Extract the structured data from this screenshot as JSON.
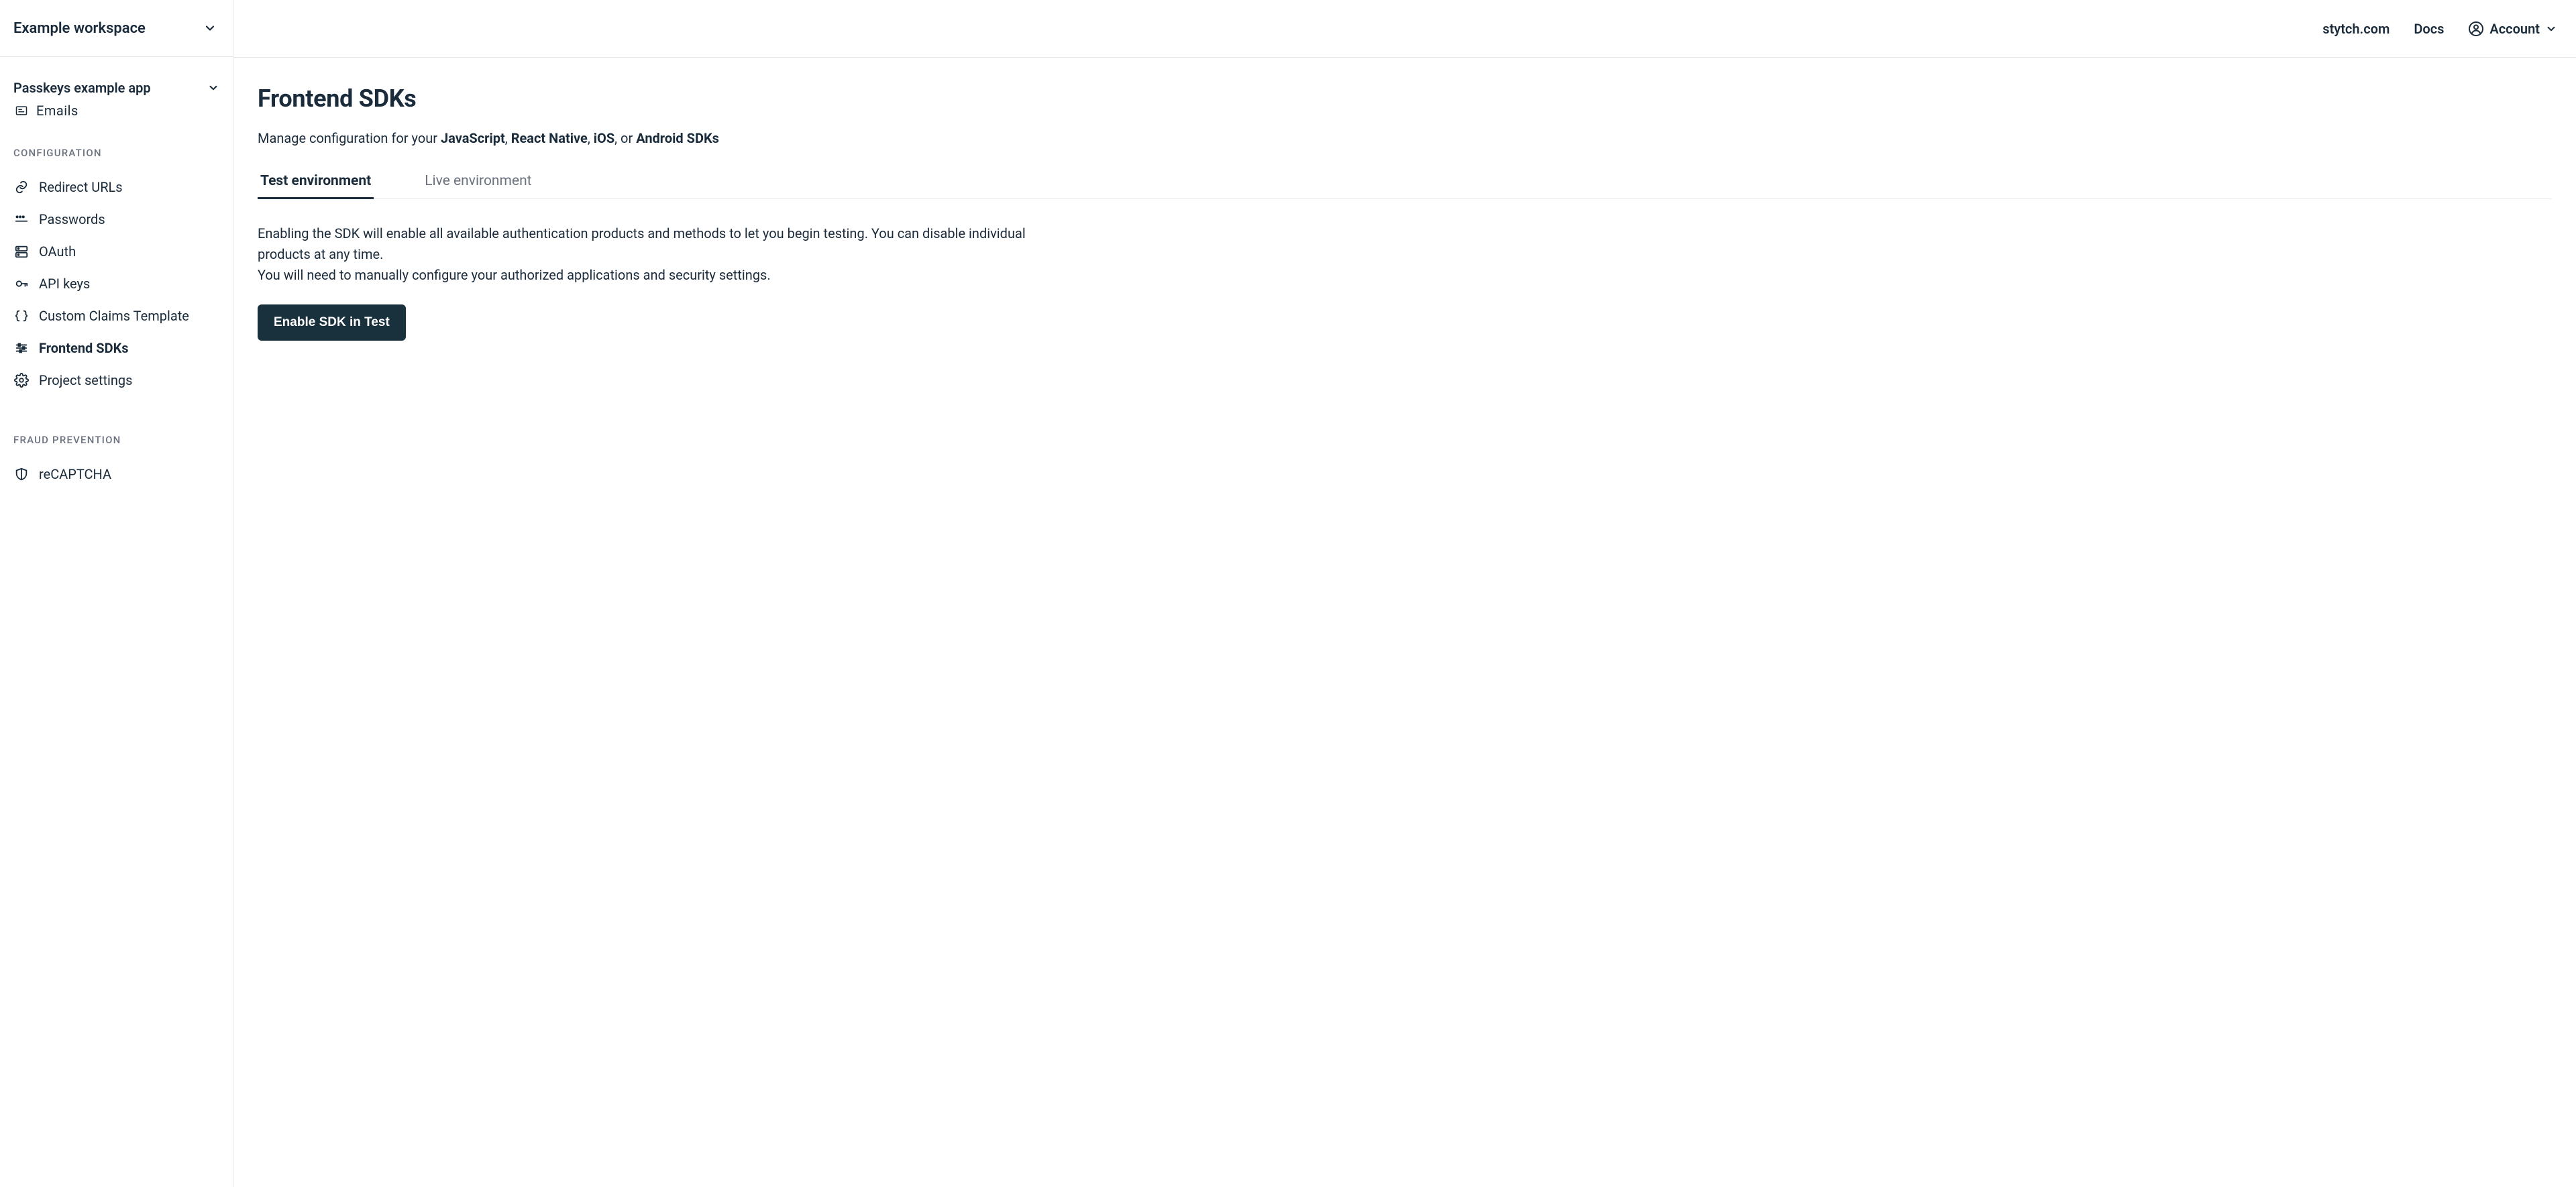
{
  "workspace": {
    "title": "Example workspace"
  },
  "project": {
    "name": "Passkeys example app"
  },
  "emails": {
    "label": "Emails"
  },
  "sections": {
    "configuration": "CONFIGURATION",
    "fraud_prevention": "FRAUD PREVENTION"
  },
  "nav": {
    "redirect_urls": "Redirect URLs",
    "passwords": "Passwords",
    "oauth": "OAuth",
    "api_keys": "API keys",
    "custom_claims": "Custom Claims Template",
    "frontend_sdks": "Frontend SDKs",
    "project_settings": "Project settings",
    "recaptcha": "reCAPTCHA"
  },
  "topbar": {
    "site": "stytch.com",
    "docs": "Docs",
    "account": "Account"
  },
  "page": {
    "title": "Frontend SDKs",
    "subtitle_prefix": "Manage configuration for your ",
    "subtitle_js": "JavaScript",
    "subtitle_sep1": ", ",
    "subtitle_rn": "React Native",
    "subtitle_sep2": ", ",
    "subtitle_ios": "iOS",
    "subtitle_sep3": ", or ",
    "subtitle_android": "Android SDKs"
  },
  "tabs": {
    "test": "Test environment",
    "live": "Live environment"
  },
  "body": {
    "p1": "Enabling the SDK will enable all available authentication products and methods to let you begin testing. You can disable individual products at any time.",
    "p2": "You will need to manually configure your authorized applications and security settings."
  },
  "cta": {
    "enable_test": "Enable SDK in Test"
  }
}
